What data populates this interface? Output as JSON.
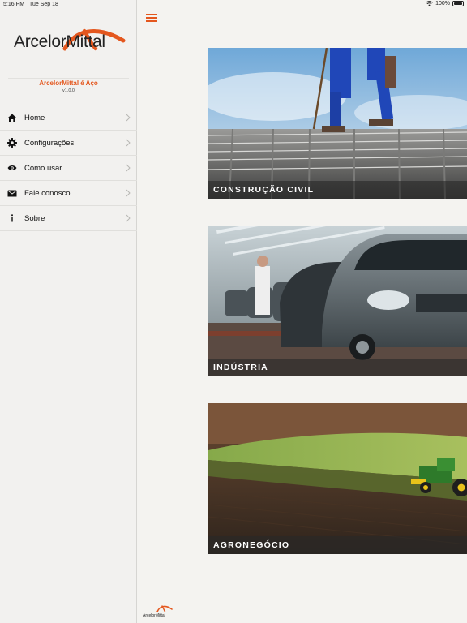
{
  "status": {
    "time": "5:16 PM",
    "date": "Tue Sep 18",
    "battery": "100%",
    "battery_level": 1.0
  },
  "sidebar": {
    "brand": "ArcelorMittal",
    "tagline": "ArcelorMittal é Aço",
    "version": "v1.0.0",
    "items": [
      {
        "label": "Home",
        "icon": "home-icon"
      },
      {
        "label": "Configurações",
        "icon": "gear-icon"
      },
      {
        "label": "Como usar",
        "icon": "eye-icon"
      },
      {
        "label": "Fale conosco",
        "icon": "envelope-icon"
      },
      {
        "label": "Sobre",
        "icon": "info-icon"
      }
    ]
  },
  "main": {
    "cards": [
      {
        "label": "CONSTRUÇÃO CIVIL"
      },
      {
        "label": "INDÚSTRIA"
      },
      {
        "label": "AGRONEGÓCIO"
      }
    ],
    "footer_brand": "ArcelorMittal"
  },
  "colors": {
    "accent": "#e4571e",
    "sidebar_bg": "#f2f1ef",
    "main_bg": "#f4f3f0"
  }
}
